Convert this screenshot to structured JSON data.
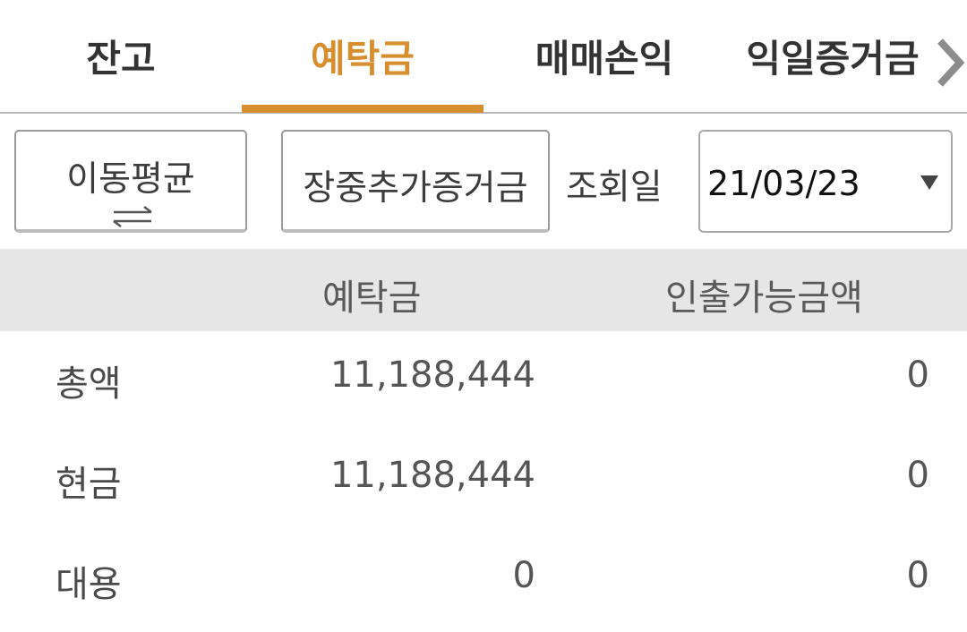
{
  "tabs": [
    {
      "label": "잔고"
    },
    {
      "label": "예탁금"
    },
    {
      "label": "매매손익"
    },
    {
      "label": "익일증거금"
    }
  ],
  "active_tab": "예탁금",
  "controls": {
    "moving_avg_label": "이동평균",
    "margin_label": "장중추가증거금",
    "query_date_label": "조회일",
    "date_value": "21/03/23"
  },
  "table": {
    "headers": [
      "예탁금",
      "인출가능금액"
    ],
    "rows": [
      {
        "label": "총액",
        "deposit": "11,188,444",
        "withdrawable": "0"
      },
      {
        "label": "현금",
        "deposit": "11,188,444",
        "withdrawable": "0"
      },
      {
        "label": "대용",
        "deposit": "0",
        "withdrawable": "0"
      }
    ]
  },
  "colors": {
    "accent": "#d68e2e",
    "header_bg": "#e6e6e6",
    "text": "#444444"
  },
  "icons": [
    "chevron-right-icon",
    "swap-arrows-icon",
    "dropdown-caret-icon"
  ]
}
